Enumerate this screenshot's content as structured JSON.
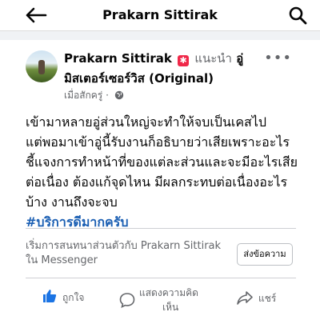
{
  "header": {
    "title": "Prakarn Sittirak"
  },
  "post": {
    "author": "Prakarn Sittirak",
    "recommend_label": "แนะนำ",
    "recommend_target_a": "อู่",
    "recommend_target_b": "มิสเตอร์เซอร์วิส (Original)",
    "time": "เมื่อสักครู่ ·",
    "lines": [
      "เข้ามาหลายอู่ส่วนใหญ่จะทำให้จบเป็นเคสไป",
      "แต่พอมาเข้าอู่นี้รับงานก็อธิบายว่าเสียเพราะอะไร",
      "ชี้แจงการทำหน้าที่ของแต่ละส่วนและจะมีอะไรเสีย",
      "ต่อเนื่อง ต้องแก้จุดไหน มีผลกระทบต่อเนื่องอะไร",
      "บ้าง งานถึงจะจบ"
    ],
    "hashtag": "#บริการดีมากครับ"
  },
  "messenger": {
    "prompt_line1": "เริ่มการสนทนาส่วนตัวกับ Prakarn Sittirak",
    "prompt_line2": "ใน Messenger",
    "send_label": "ส่งข้อความ"
  },
  "actions": {
    "like_label": "ถูกใจ",
    "comment_label_1": "แสดงความคิด",
    "comment_label_2": "เห็น",
    "share_label": "แชร์"
  },
  "colors": {
    "accent": "#1b74e4",
    "hashtag": "#1b5fb3",
    "muted": "#65676b"
  },
  "icons": [
    "back-arrow-icon",
    "search-icon",
    "badge-icon",
    "globe-icon",
    "more-icon",
    "like-icon",
    "comment-icon",
    "share-icon"
  ]
}
